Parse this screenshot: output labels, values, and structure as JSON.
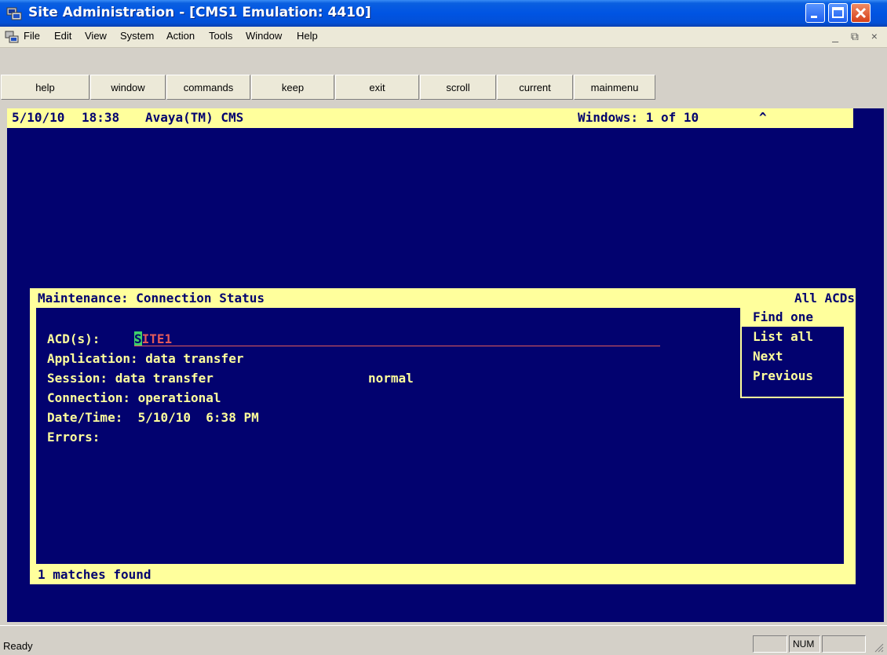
{
  "window": {
    "title": "Site Administration - [CMS1 Emulation: 4410]",
    "controls": [
      "minimize",
      "maximize",
      "close"
    ]
  },
  "menu": {
    "items": [
      "File",
      "Edit",
      "View",
      "System",
      "Action",
      "Tools",
      "Window",
      "Help"
    ],
    "mdi_controls": "_ ⧉ ×"
  },
  "toolbar": {
    "buttons": [
      "help",
      "window",
      "commands",
      "keep",
      "exit",
      "scroll",
      "current",
      "mainmenu"
    ]
  },
  "terminal": {
    "date": "5/10/10",
    "time": "18:38",
    "product": "Avaya(TM) CMS",
    "windows_count": "Windows: 1 of 10",
    "scroll_indicator": "^",
    "window": {
      "title": "Maintenance: Connection Status",
      "scope": "All ACDs",
      "acd_label": "ACD(s):",
      "acd_cursor": "S",
      "acd_value": "SITE1",
      "application": "Application: data transfer",
      "session": "Session: data transfer",
      "session_mode": "normal",
      "connection": "Connection: operational",
      "datetime": "Date/Time:  5/10/10  6:38 PM",
      "errors": "Errors:",
      "actions": [
        "Find one",
        "List all",
        "Next",
        "Previous"
      ],
      "matches": "1 matches found"
    }
  },
  "statusbar": {
    "text": "Ready",
    "panes": [
      "",
      "NUM",
      ""
    ]
  },
  "colors": {
    "terminal_bg": "#02026f",
    "highlight": "#ffff9c",
    "input_value": "#e25a5a",
    "cursor": "#3fd06a"
  }
}
